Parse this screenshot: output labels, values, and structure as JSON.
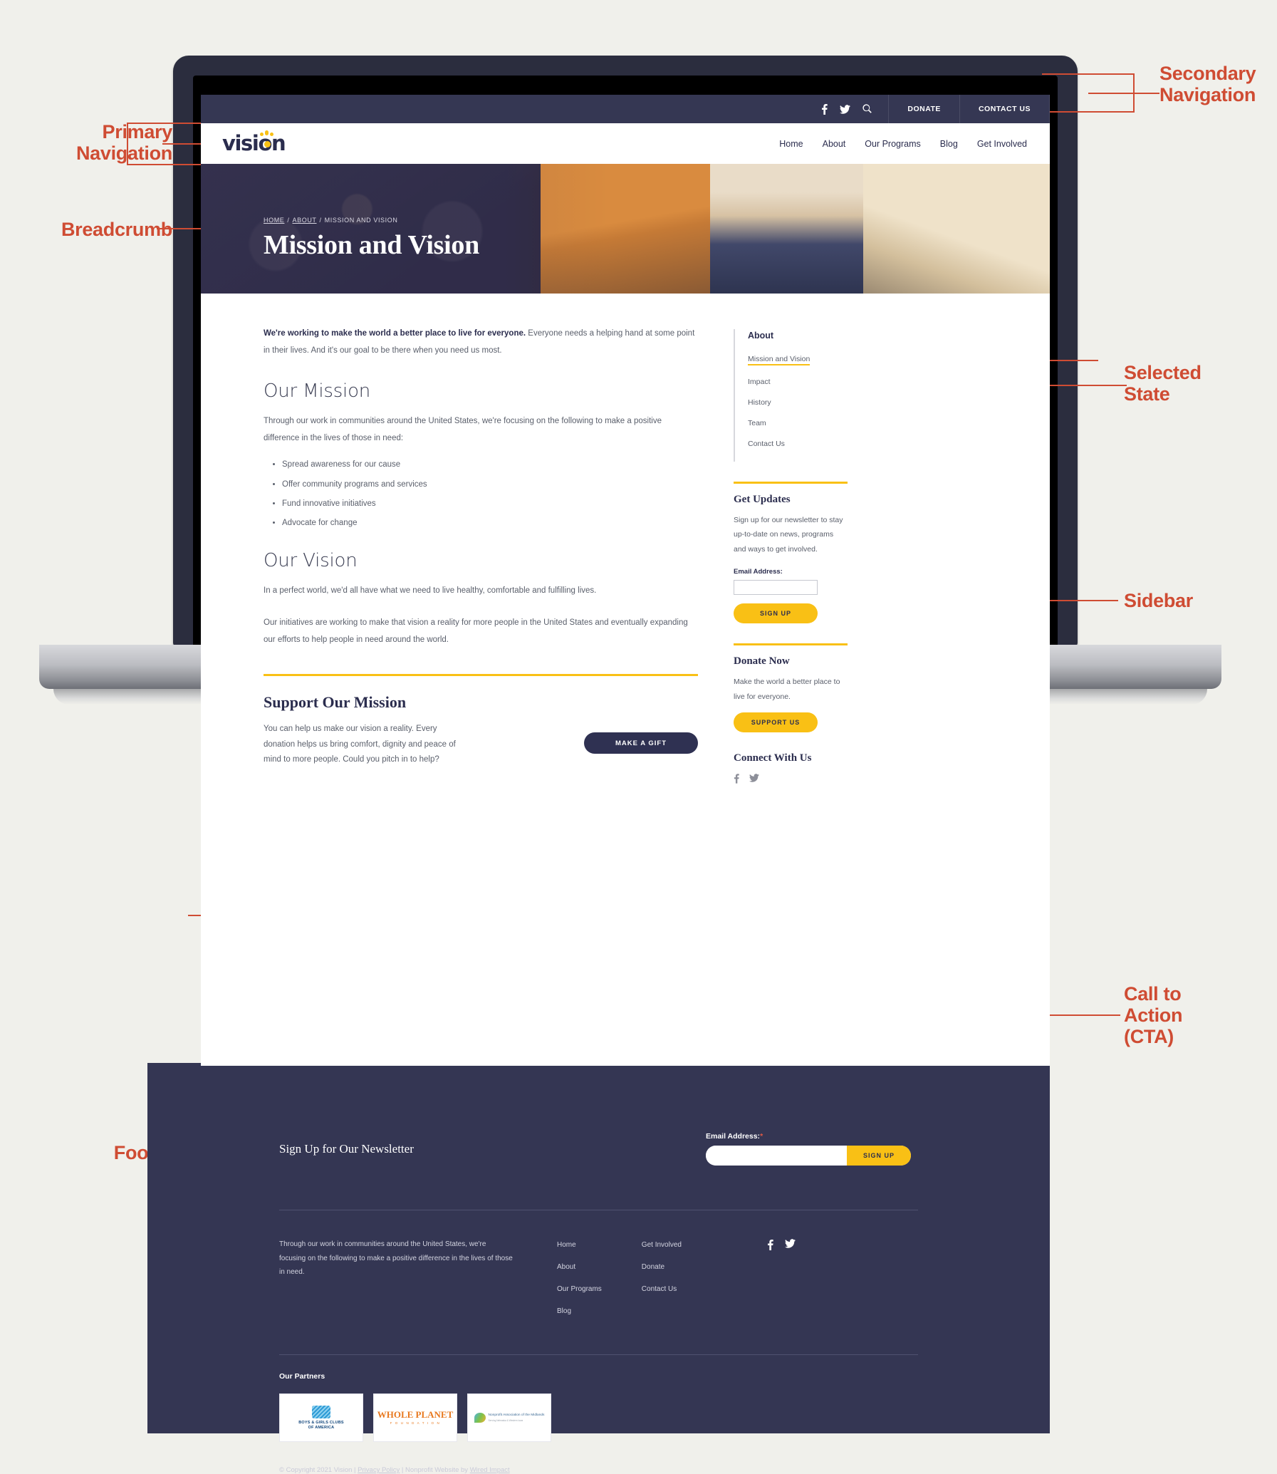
{
  "annotations": [
    {
      "id": "primary_navigation",
      "text": "Primary\nNavigation"
    },
    {
      "id": "secondary_navigation",
      "text": "Secondary\nNavigation"
    },
    {
      "id": "breadcrumb",
      "text": "Breadcrumb"
    },
    {
      "id": "selected_state",
      "text": "Selected\nState"
    },
    {
      "id": "sidebar",
      "text": "Sidebar"
    },
    {
      "id": "call_to_action",
      "text": "Call to\nAction\n(CTA)"
    },
    {
      "id": "footer",
      "text": "Footer"
    }
  ],
  "colors": {
    "annotation": "#cf4c33",
    "navy": "#2b2d4e",
    "navy_bar": "#353753",
    "footer_navy": "#343653",
    "yellow": "#f9c015",
    "page_bg": "#f0f0eb",
    "body_text": "#5a5f6b"
  },
  "secondary_nav": {
    "icons": [
      "facebook-icon",
      "twitter-icon",
      "search-icon"
    ],
    "links": [
      "DONATE",
      "CONTACT US"
    ]
  },
  "primary_nav": {
    "logo": "vision",
    "links": [
      "Home",
      "About",
      "Our Programs",
      "Blog",
      "Get Involved"
    ]
  },
  "hero": {
    "breadcrumb": [
      "HOME",
      "ABOUT",
      "MISSION AND VISION"
    ],
    "breadcrumb_separator": "/",
    "title": "Mission and Vision"
  },
  "main": {
    "lede_bold": "We're working to make the world a better place to live for everyone.",
    "lede_rest": " Everyone needs a helping hand at some point in their lives. And it's our goal to be there when you need us most.",
    "mission_heading": "Our Mission",
    "mission_intro": "Through our work in communities around the United States, we're focusing on the following to make a positive difference in the lives of those in need:",
    "mission_bullets": [
      "Spread awareness for our cause",
      "Offer community programs and services",
      "Fund innovative initiatives",
      "Advocate for change"
    ],
    "vision_heading": "Our Vision",
    "vision_p1": "In a perfect world, we'd all have what we need to live healthy, comfortable and fulfilling lives.",
    "vision_p2": "Our initiatives are working to make that vision a reality for more people in the United States and eventually expanding our efforts to help people in need around the world.",
    "support_heading": "Support Our Mission",
    "support_text": "You can help us make our vision a reality. Every donation helps us bring comfort, dignity and peace of mind to more people. Could you pitch in to help?",
    "support_button": "MAKE A GIFT"
  },
  "sidebar": {
    "nav_heading": "About",
    "nav_items": [
      {
        "label": "Mission and Vision",
        "selected": true
      },
      {
        "label": "Impact",
        "selected": false
      },
      {
        "label": "History",
        "selected": false
      },
      {
        "label": "Team",
        "selected": false
      },
      {
        "label": "Contact Us",
        "selected": false
      }
    ],
    "updates": {
      "heading": "Get Updates",
      "text": "Sign up for our newsletter to stay up-to-date on news, programs and ways to get involved.",
      "field_label": "Email Address:",
      "field_value": "",
      "field_placeholder": "",
      "button": "SIGN UP"
    },
    "donate": {
      "heading": "Donate Now",
      "text": "Make the world a better place to live for everyone.",
      "button": "SUPPORT US"
    },
    "connect": {
      "heading": "Connect With Us",
      "icons": [
        "facebook-icon",
        "twitter-icon"
      ]
    }
  },
  "footer": {
    "cta": {
      "title": "Sign Up for Our Newsletter",
      "field_label": "Email Address:",
      "required_mark": "*",
      "field_value": "",
      "field_placeholder": "",
      "button": "SIGN UP"
    },
    "about_text": "Through our work in communities around the United States, we're focusing on the following to make a positive difference in the lives of those in need.",
    "links_col1": [
      "Home",
      "About",
      "Our Programs",
      "Blog"
    ],
    "links_col2": [
      "Get Involved",
      "Donate",
      "Contact Us"
    ],
    "social_icons": [
      "facebook-icon",
      "twitter-icon"
    ],
    "partners_title": "Our Partners",
    "partners": [
      {
        "name": "BOYS & GIRLS CLUBS",
        "sub": "OF AMERICA"
      },
      {
        "name": "WHOLE PLANET",
        "sub": "F O U N D A T I O N"
      },
      {
        "name": "Nonprofit Association of the Midlands",
        "sub": "Serving Nebraska & Western Iowa"
      }
    ],
    "copyright_prefix": "© Copyright 2021 Vision | ",
    "privacy_link": "Privacy Policy",
    "copyright_middle": " | Nonprofit Website by ",
    "agency_link": "Wired Impact"
  }
}
